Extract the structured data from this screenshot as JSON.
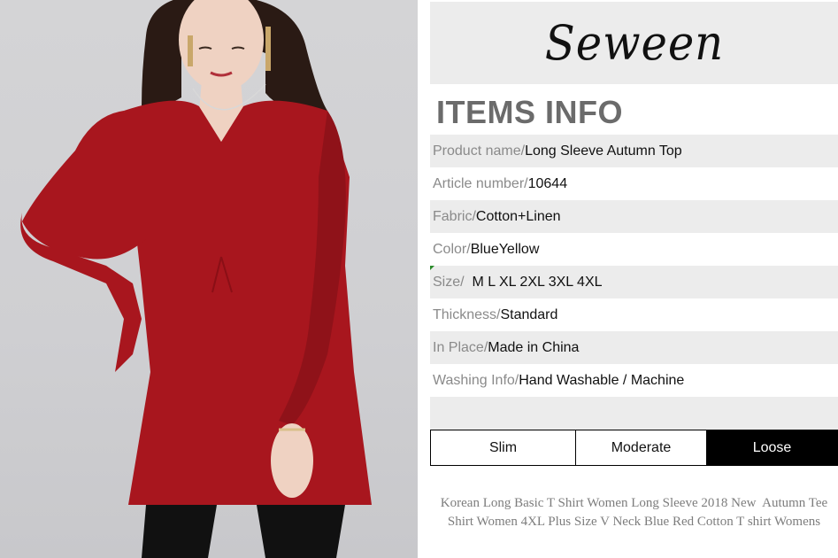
{
  "brand": {
    "name": "Seween"
  },
  "info": {
    "heading": "ITEMS INFO",
    "rows": [
      {
        "label": "Product name/ ",
        "value": "Long Sleeve Autumn Top"
      },
      {
        "label": "Article number/ ",
        "value": "10644"
      },
      {
        "label": "Fabric/ ",
        "value": "Cotton+Linen"
      },
      {
        "label": "Color/ ",
        "value": "BlueYellow"
      },
      {
        "label": "Size/  ",
        "value": "M L XL 2XL 3XL 4XL"
      },
      {
        "label": "Thickness/ ",
        "value": "Standard"
      },
      {
        "label": "In Place/ ",
        "value": "Made in China"
      },
      {
        "label": "Washing Info/",
        "value": "Hand Washable / Machine"
      }
    ]
  },
  "fit": {
    "options": [
      "Slim",
      "Moderate",
      "Loose"
    ],
    "selected": "Loose"
  },
  "description": {
    "line1": "Korean Long Basic T Shirt Women Long Sleeve 2018 New  Autumn Tee",
    "line2": "Shirt Women 4XL Plus Size V Neck Blue Red Cotton T shirt Womens"
  },
  "colors": {
    "dress": "#a8161e",
    "background_band": "#ececec",
    "heading": "#6b6b6b"
  }
}
